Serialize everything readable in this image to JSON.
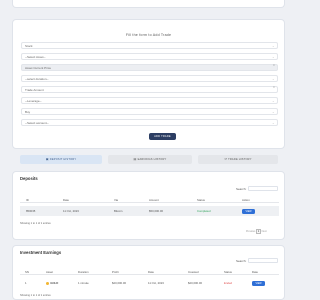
{
  "trade_form": {
    "title": "Fill the form to Add Trade",
    "fields": [
      {
        "text": "Stock",
        "kind": "select"
      },
      {
        "text": "--Select Asset--",
        "kind": "select"
      },
      {
        "text": "Asset Current Price",
        "kind": "number"
      },
      {
        "text": "--select duration--",
        "kind": "select"
      },
      {
        "text": "Trade Amount",
        "kind": "number"
      },
      {
        "text": "--Leverage--",
        "kind": "select"
      },
      {
        "text": "Buy",
        "kind": "select"
      },
      {
        "text": "--Select account--",
        "kind": "select"
      }
    ],
    "submit_label": "ADD TRADE"
  },
  "tabs": [
    {
      "label": "DEPOSIT HISTORY",
      "icon": "wallet-icon",
      "active": true
    },
    {
      "label": "EARNINGS HISTORY",
      "icon": "chart-icon",
      "active": false
    },
    {
      "label": "TRADE HISTORY",
      "icon": "history-icon",
      "active": false
    }
  ],
  "deposits": {
    "title": "Deposits",
    "search_label": "Search:",
    "columns": [
      "ID",
      "Date",
      "Via",
      "Amount",
      "Status",
      "Action"
    ],
    "rows": [
      {
        "id": "850035",
        "date": "11 Oct, 2023",
        "via": "Bitcoin",
        "amount": "$50,000.00",
        "status": "Completed",
        "action": "VIEW"
      }
    ],
    "showing": "Showing 1 to 1 of 1 entries",
    "prev": "Previous",
    "page": "1",
    "next": "Next"
  },
  "earnings": {
    "title": "Investment Earnings",
    "search_label": "Search:",
    "columns": [
      "SN",
      "Asset",
      "Duration",
      "Profit",
      "Date",
      "Invested",
      "Status",
      "Date"
    ],
    "rows": [
      {
        "sn": "1",
        "asset": "GOLD",
        "duration": "1 minute",
        "profit": "$20,000.00",
        "date": "11 Oct, 2023",
        "invested": "$20,000.00",
        "status": "Ended",
        "action": "VIEW"
      }
    ],
    "showing": "Showing 1 to 1 of 1 entries",
    "colors": {
      "completed": "#2fa35a",
      "ended": "#e05050",
      "view": "#2f6fd6"
    }
  }
}
